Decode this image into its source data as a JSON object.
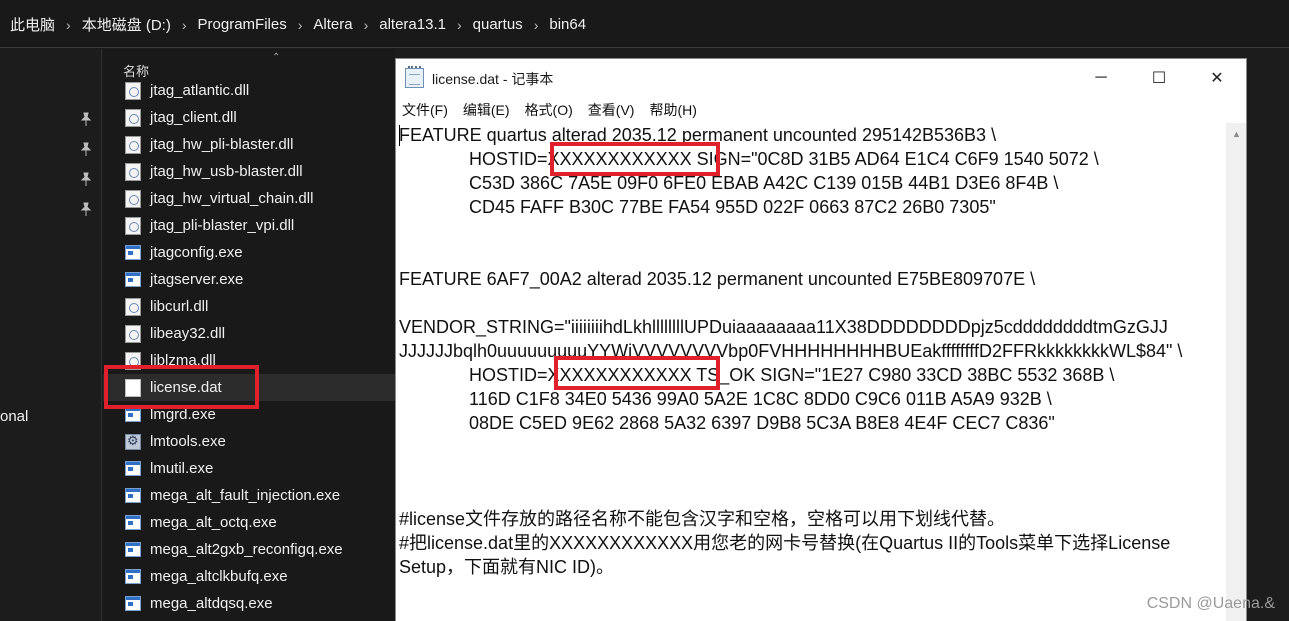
{
  "address_bar": {
    "crumbs": [
      "此电脑",
      "本地磁盘 (D:)",
      "ProgramFiles",
      "Altera",
      "altera13.1",
      "quartus",
      "bin64"
    ],
    "separator": "›"
  },
  "nav_pane": {
    "partial_label": "onal",
    "pin_icon": "pin-icon"
  },
  "file_list": {
    "column_header": "名称",
    "files": [
      {
        "name": "jtag_atlantic.dll",
        "icon": "dll-file-icon"
      },
      {
        "name": "jtag_client.dll",
        "icon": "dll-file-icon"
      },
      {
        "name": "jtag_hw_pli-blaster.dll",
        "icon": "dll-file-icon"
      },
      {
        "name": "jtag_hw_usb-blaster.dll",
        "icon": "dll-file-icon"
      },
      {
        "name": "jtag_hw_virtual_chain.dll",
        "icon": "dll-file-icon"
      },
      {
        "name": "jtag_pli-blaster_vpi.dll",
        "icon": "dll-file-icon"
      },
      {
        "name": "jtagconfig.exe",
        "icon": "exe-file-icon"
      },
      {
        "name": "jtagserver.exe",
        "icon": "exe-file-icon"
      },
      {
        "name": "libcurl.dll",
        "icon": "dll-file-icon"
      },
      {
        "name": "libeay32.dll",
        "icon": "dll-file-icon"
      },
      {
        "name": "liblzma.dll",
        "icon": "dll-file-icon"
      },
      {
        "name": "license.dat",
        "icon": "text-file-icon",
        "selected": true
      },
      {
        "name": "lmgrd.exe",
        "icon": "exe-file-icon"
      },
      {
        "name": "lmtools.exe",
        "icon": "tools-file-icon"
      },
      {
        "name": "lmutil.exe",
        "icon": "exe-file-icon"
      },
      {
        "name": "mega_alt_fault_injection.exe",
        "icon": "exe-file-icon"
      },
      {
        "name": "mega_alt_octq.exe",
        "icon": "exe-file-icon"
      },
      {
        "name": "mega_alt2gxb_reconfigq.exe",
        "icon": "exe-file-icon"
      },
      {
        "name": "mega_altclkbufq.exe",
        "icon": "exe-file-icon"
      },
      {
        "name": "mega_altdqsq.exe",
        "icon": "exe-file-icon"
      }
    ]
  },
  "notepad": {
    "title": "license.dat - 记事本",
    "buttons": {
      "minimize": "─",
      "maximize": "☐",
      "close": "✕"
    },
    "menu": [
      "文件(F)",
      "编辑(E)",
      "格式(O)",
      "查看(V)",
      "帮助(H)"
    ],
    "lines": [
      "FEATURE quartus alterad 2035.12 permanent uncounted 295142B536B3 \\",
      "              HOSTID=XXXXXXXXXXXX SIGN=\"0C8D 31B5 AD64 E1C4 C6F9 1540 5072 \\",
      "              C53D 386C 7A5E 09F0 6FE0 EBAB A42C C139 015B 44B1 D3E6 8F4B \\",
      "              CD45 FAFF B30C 77BE FA54 955D 022F 0663 87C2 26B0 7305\"",
      "",
      "",
      "FEATURE 6AF7_00A2 alterad 2035.12 permanent uncounted E75BE809707E \\",
      "",
      "VENDOR_STRING=\"iiiiiiiihdLkhllllllllUPDuiaaaaaaaa11X38DDDDDDDDpjz5cddddddddtmGzGJJ",
      "JJJJJJbqlh0uuuuuuuuuYYWiVVVVVVVVbp0FVHHHHHHHHBUEakffffffffD2FFRkkkkkkkkWL$84\" \\",
      "              HOSTID=XXXXXXXXXXXX TS_OK SIGN=\"1E27 C980 33CD 38BC 5532 368B \\",
      "              116D C1F8 34E0 5436 99A0 5A2E 1C8C 8DD0 C9C6 011B A5A9 932B \\",
      "              08DE C5ED 9E62 2868 5A32 6397 D9B8 5C3A B8E8 4E4F CEC7 C836\"",
      "",
      "",
      "",
      "#license文件存放的路径名称不能包含汉字和空格，空格可以用下划线代替。",
      "#把license.dat里的XXXXXXXXXXXX用您老的网卡号替换(在Quartus II的Tools菜单下选择License",
      "Setup，下面就有NIC ID)。"
    ]
  },
  "watermark": "CSDN @Uaena.&",
  "highlight_color": "#e0202b"
}
